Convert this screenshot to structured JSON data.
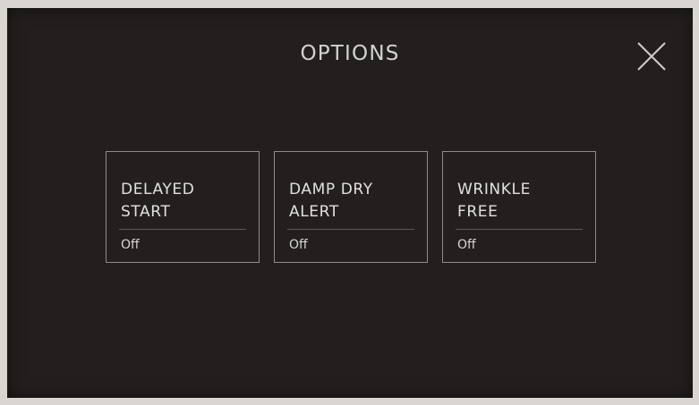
{
  "header": {
    "title": "OPTIONS",
    "close_icon": "close-x-icon"
  },
  "options": [
    {
      "name_line1": "DELAYED",
      "name_line2": "START",
      "value": "Off"
    },
    {
      "name_line1": "DAMP DRY",
      "name_line2": "ALERT",
      "value": "Off"
    },
    {
      "name_line1": "WRINKLE",
      "name_line2": "FREE",
      "value": "Off"
    }
  ],
  "colors": {
    "screen_background": "#231f1e",
    "bezel": "#d9d6d1",
    "text": "#e2e0dd",
    "card_border": "#8f8c89"
  }
}
